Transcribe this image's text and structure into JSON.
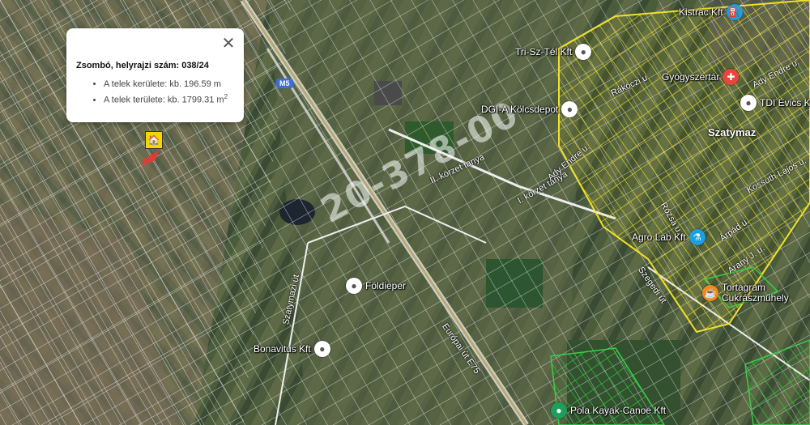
{
  "popup": {
    "title": "Zsombó, helyrajzi szám: 038/24",
    "perimeter": "A telek kerülete: kb. 196.59 m",
    "area_prefix": "A telek területe: kb. 1799.31 m",
    "area_sup": "2",
    "close_icon": "close-icon"
  },
  "town": "Szatymaz",
  "road_shield": "M5",
  "watermark": "20-378-00",
  "roads": {
    "szatymazi": "Szatymazi út",
    "europai": "Európai út E75",
    "koszeri": "II. körzet tanya",
    "koszeri2": "I. körzet tanya",
    "ady": "Ady Endre u.",
    "kossuth": "Kossuth Lajos u.",
    "rakoczi": "Rákóczi u.",
    "rozsa": "Rózsa u.",
    "arpad": "Árpád u.",
    "arany": "Arany J. u.",
    "szegedi": "Szegedi út",
    "ady2": "Ady Endre u."
  },
  "pois": {
    "kistrac": "Kistrac Kft",
    "tri": "Tri-Sz-Tél Kft",
    "gyogyszertar": "Gyógyszertár",
    "tdi": "TDI Évics Kegad",
    "dgi": "DGI-A Kölcsdepot",
    "agro": "Agro Lab Kft",
    "tortagram_1": "Tortagram",
    "tortagram_2": "Cukrászműhely",
    "foldieper": "Földieper",
    "bonavitus": "Bonavitus Kft",
    "pola": "Pola Kayak-Canoe Kft"
  },
  "colors": {
    "parcel_line": "#e8e8e8",
    "highlight_yellow": "#f0e12a",
    "highlight_green": "#38d048",
    "field_dark": "#3f5535",
    "field_light": "#8a8060"
  }
}
